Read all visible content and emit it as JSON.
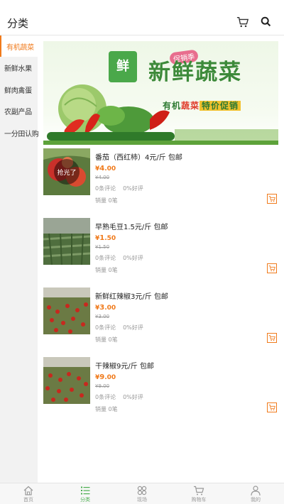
{
  "header": {
    "title": "分类",
    "cart_icon": "cart-icon",
    "search_icon": "search-icon"
  },
  "sidebar": {
    "items": [
      {
        "label": "有机蔬菜",
        "active": true
      },
      {
        "label": "新鲜水果",
        "active": false
      },
      {
        "label": "鲜肉禽蛋",
        "active": false
      },
      {
        "label": "农副产品",
        "active": false
      },
      {
        "label": "一分田认购",
        "active": false
      }
    ]
  },
  "banner": {
    "logo": "鲜",
    "tag": "促销季",
    "headline": "新鲜蔬菜",
    "sub_a": "有机",
    "sub_b": "蔬菜",
    "sub_c": "特价促销"
  },
  "products": [
    {
      "name": "番茄（西红柿）4元/斤 包邮",
      "currency": "¥",
      "price_int": "4",
      "price_dec": ".00",
      "old_price": "¥4.00",
      "comments": "0条评论",
      "rating": "0%好评",
      "sales": "销量 0笔",
      "badge": "抢光了"
    },
    {
      "name": "早熟毛豆1.5元/斤 包邮",
      "currency": "¥",
      "price_int": "1",
      "price_dec": ".50",
      "old_price": "¥1.50",
      "comments": "0条评论",
      "rating": "0%好评",
      "sales": "销量 0笔",
      "badge": ""
    },
    {
      "name": "新鲜红辣椒3元/斤 包邮",
      "currency": "¥",
      "price_int": "3",
      "price_dec": ".00",
      "old_price": "¥3.00",
      "comments": "0条评论",
      "rating": "0%好评",
      "sales": "销量 0笔",
      "badge": ""
    },
    {
      "name": "干辣椒9元/斤 包邮",
      "currency": "¥",
      "price_int": "9",
      "price_dec": ".00",
      "old_price": "¥9.00",
      "comments": "0条评论",
      "rating": "0%好评",
      "sales": "销量 0笔",
      "badge": ""
    }
  ],
  "tabbar": {
    "items": [
      {
        "label": "首页",
        "icon": "home-icon",
        "active": false
      },
      {
        "label": "分类",
        "icon": "category-list-icon",
        "active": true
      },
      {
        "label": "现场",
        "icon": "grid-circles-icon",
        "active": false
      },
      {
        "label": "购物车",
        "icon": "cart-icon",
        "active": false
      },
      {
        "label": "我的",
        "icon": "user-icon",
        "active": false
      }
    ]
  },
  "colors": {
    "accent": "#f07a1b",
    "green": "#4caf50",
    "sidebar_bg": "#f2f2f2"
  }
}
